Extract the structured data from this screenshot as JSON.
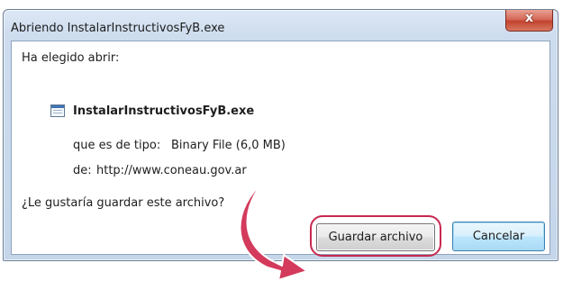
{
  "window": {
    "title": "Abriendo InstalarInstructivosFyB.exe",
    "close_label": "x"
  },
  "dialog": {
    "intro": "Ha elegido abrir:",
    "file_name": "InstalarInstructivosFyB.exe",
    "type_label": "que es de tipo:",
    "type_value": "Binary File (6,0 MB)",
    "from_label": "de:",
    "from_value": "http://www.coneau.gov.ar",
    "question": "¿Le gustaría guardar este archivo?"
  },
  "buttons": {
    "save_label": "Guardar archivo",
    "cancel_label": "Cancelar"
  },
  "annotation": {
    "arrow_color": "#d33a5c",
    "ring_color": "#c8284f"
  }
}
